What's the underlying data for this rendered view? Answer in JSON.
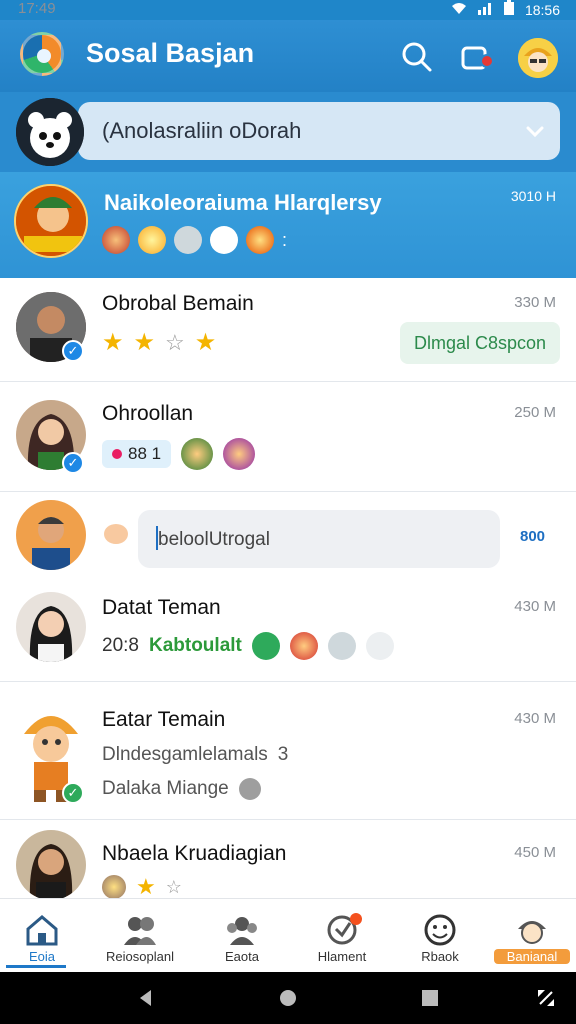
{
  "status": {
    "time": "17:49",
    "right_time": "18:56"
  },
  "app": {
    "title": "Sosal Basjan"
  },
  "account": {
    "selected": "(Anolasraliin oDorah"
  },
  "featured": {
    "name": "Naikoleoraiuma Hlarqlersy",
    "time": "3010 H",
    "extra": ":"
  },
  "items": [
    {
      "name": "Obrobal Bemain",
      "time": "330 M",
      "action_label": "Dlmgal C8spcon"
    },
    {
      "name": "Ohroollan",
      "time": "250 M",
      "chip_text": "88 1"
    },
    {
      "compose_text": "beloolUtrogal",
      "count": "800"
    },
    {
      "name": "Datat Teman",
      "time": "430 M",
      "sub_prefix": "20:8",
      "sub_green": "Kabtoulalt"
    },
    {
      "name": "Eatar Temain",
      "time": "430 M",
      "line1": "Dlndesgamlelamals",
      "line1_suffix": "3",
      "line2": "Dalaka Miange"
    },
    {
      "name": "Nbaela Kruadiagian",
      "time": "450 M"
    }
  ],
  "nav": [
    {
      "label": "Eoia",
      "active": true
    },
    {
      "label": "Reiosoplanl"
    },
    {
      "label": "Eaota"
    },
    {
      "label": "Hlament"
    },
    {
      "label": "Rbaok"
    },
    {
      "label": "Banianal"
    }
  ],
  "colors": {
    "primary": "#2a8bcf",
    "accent_green": "#2c9a3a",
    "verify_blue": "#1e88e5"
  }
}
